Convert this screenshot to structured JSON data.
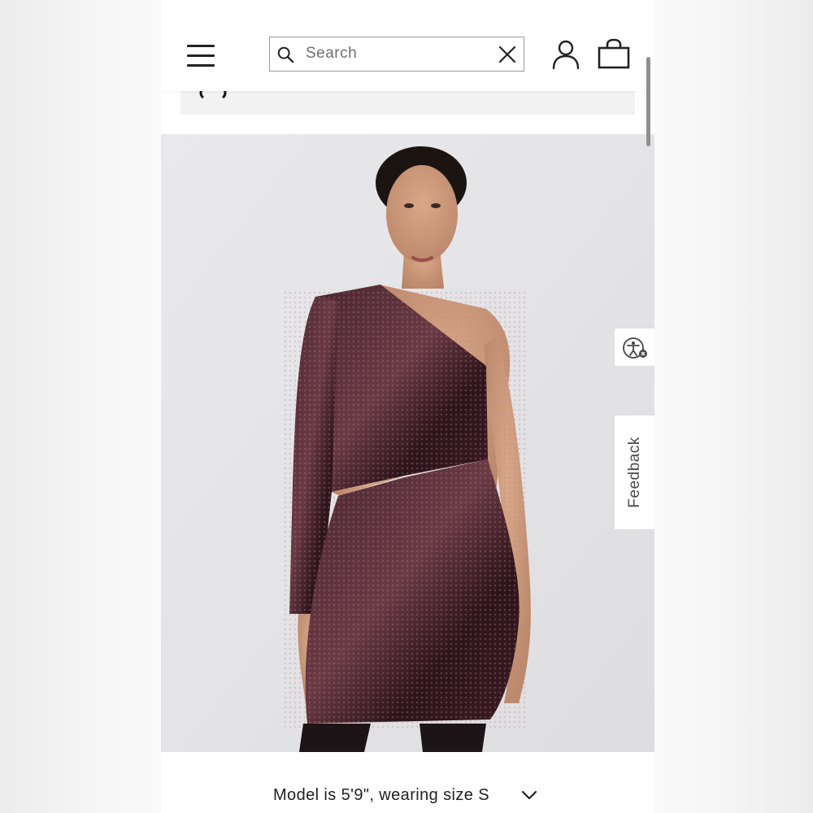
{
  "header": {
    "search": {
      "placeholder": "Search",
      "value": ""
    },
    "icons": {
      "menu": "hamburger-icon",
      "search": "search-icon",
      "clear": "close-icon",
      "account": "user-icon",
      "bag": "shopping-bag-icon"
    }
  },
  "product": {
    "image_description_icon": "product-photo",
    "model_info": "Model is 5'9\", wearing size S"
  },
  "widgets": {
    "feedback_label": "Feedback",
    "accessibility_icon": "accessibility-icon"
  },
  "colors": {
    "dress": "#3a1a22",
    "background": "#e4e4e6",
    "text": "#222222"
  }
}
